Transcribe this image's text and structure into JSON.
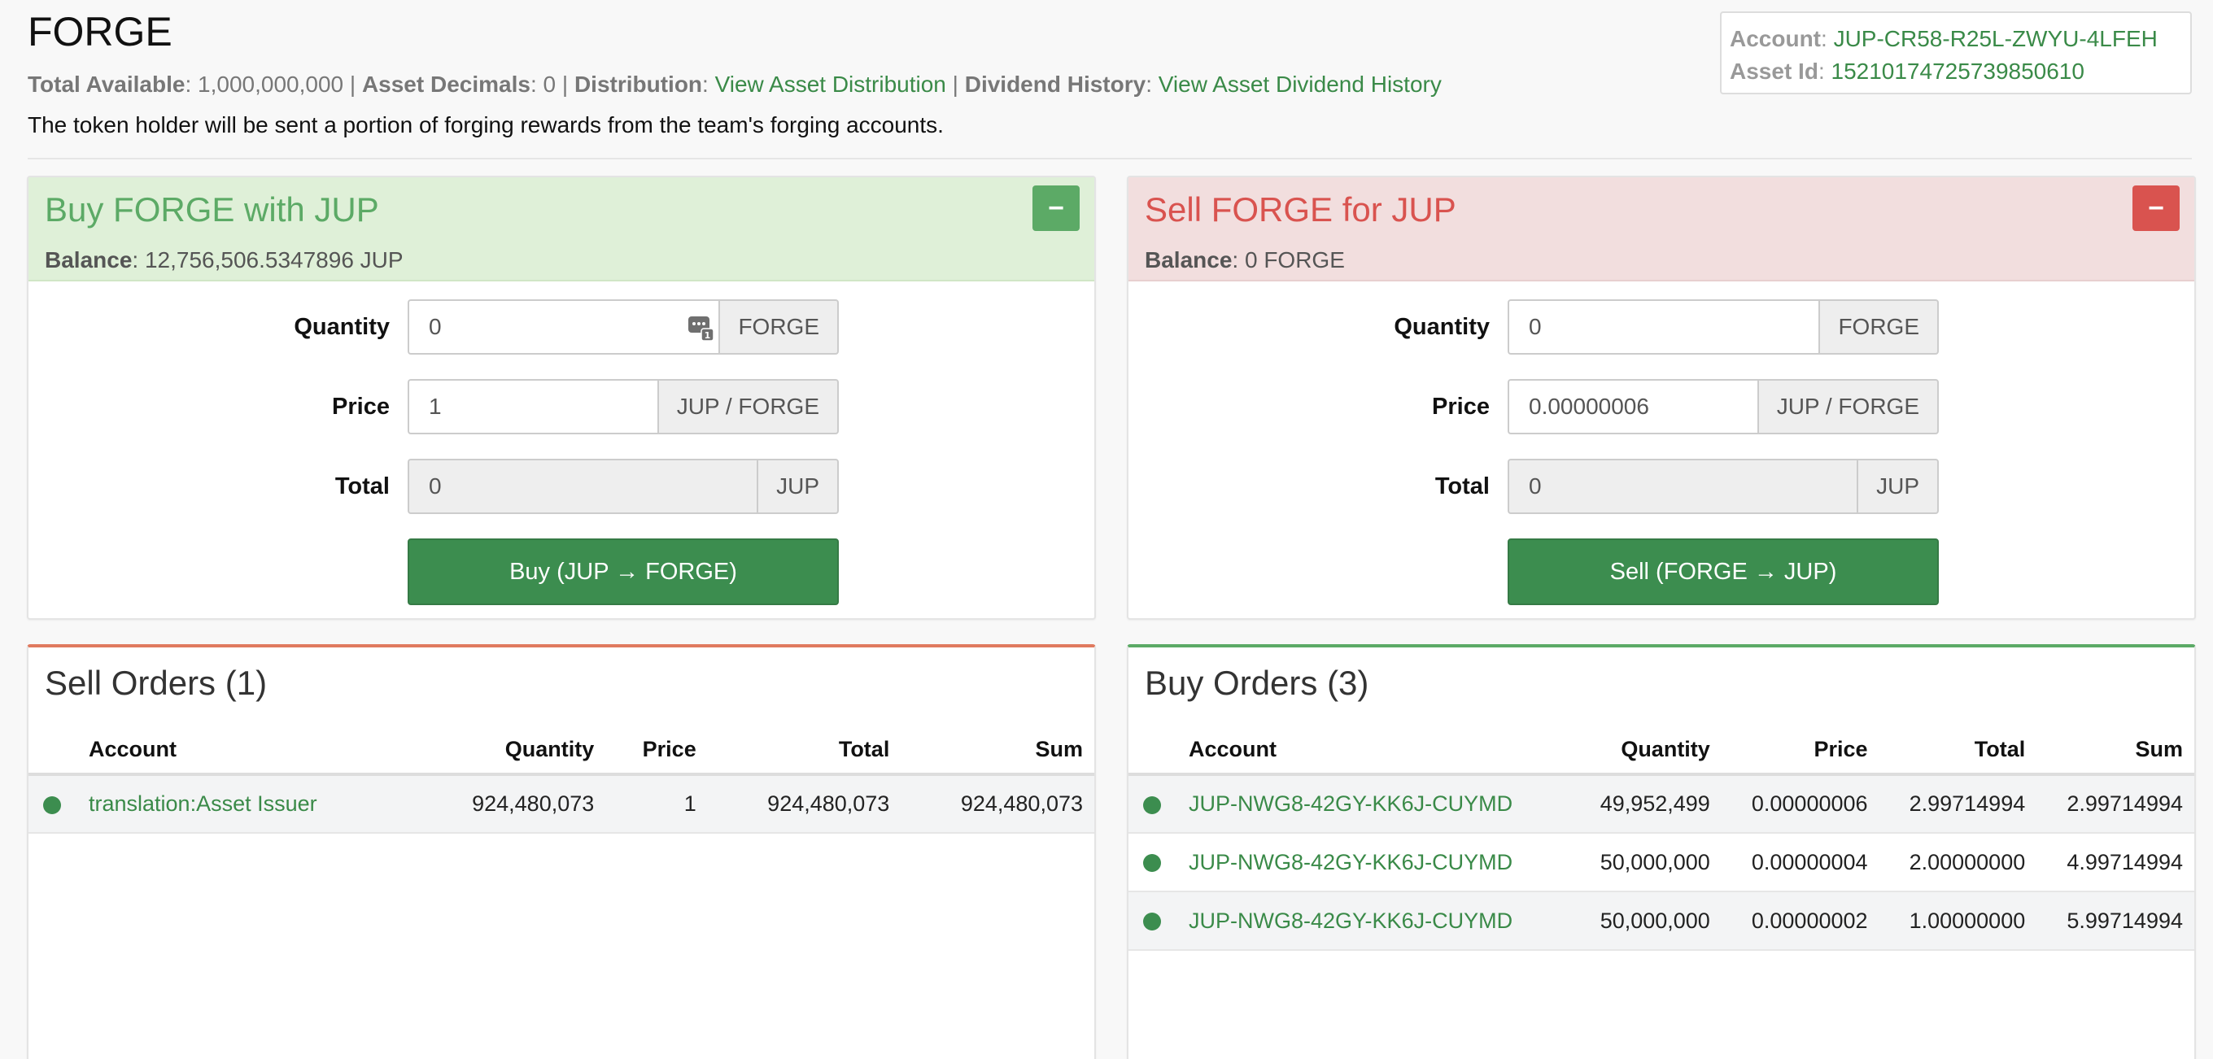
{
  "asset": {
    "name": "FORGE",
    "total_available_label": "Total Available",
    "total_available": "1,000,000,000",
    "decimals_label": "Asset Decimals",
    "decimals": "0",
    "distribution_label": "Distribution",
    "distribution_link": "View Asset Distribution",
    "dividend_label": "Dividend History",
    "dividend_link": "View Asset Dividend History",
    "description": "The token holder will be sent a portion of forging rewards from the team's forging accounts."
  },
  "info_box": {
    "account_label": "Account",
    "account": "JUP-CR58-R25L-ZWYU-4LFEH",
    "asset_id_label": "Asset Id",
    "asset_id": "15210174725739850610"
  },
  "buy_panel": {
    "title": "Buy FORGE with JUP",
    "balance_label": "Balance",
    "balance": "12,756,506.5347896 JUP",
    "collapse": "−",
    "quantity_label": "Quantity",
    "quantity_value": "0",
    "quantity_unit": "FORGE",
    "price_label": "Price",
    "price_value": "1",
    "price_unit": "JUP / FORGE",
    "total_label": "Total",
    "total_value": "0",
    "total_unit": "JUP",
    "button": "Buy (JUP → FORGE)"
  },
  "sell_panel": {
    "title": "Sell FORGE for JUP",
    "balance_label": "Balance",
    "balance": "0 FORGE",
    "collapse": "−",
    "quantity_label": "Quantity",
    "quantity_value": "0",
    "quantity_unit": "FORGE",
    "price_label": "Price",
    "price_value": "0.00000006",
    "price_unit": "JUP / FORGE",
    "total_label": "Total",
    "total_value": "0",
    "total_unit": "JUP",
    "button": "Sell (FORGE → JUP)"
  },
  "sell_orders": {
    "title": "Sell Orders (1)",
    "headers": [
      "Account",
      "Quantity",
      "Price",
      "Total",
      "Sum"
    ],
    "rows": [
      [
        "translation:Asset Issuer",
        "924,480,073",
        "1",
        "924,480,073",
        "924,480,073"
      ]
    ]
  },
  "buy_orders": {
    "title": "Buy Orders (3)",
    "headers": [
      "Account",
      "Quantity",
      "Price",
      "Total",
      "Sum"
    ],
    "rows": [
      [
        "JUP-NWG8-42GY-KK6J-CUYMD",
        "49,952,499",
        "0.00000006",
        "2.99714994",
        "2.99714994"
      ],
      [
        "JUP-NWG8-42GY-KK6J-CUYMD",
        "50,000,000",
        "0.00000004",
        "2.00000000",
        "4.99714994"
      ],
      [
        "JUP-NWG8-42GY-KK6J-CUYMD",
        "50,000,000",
        "0.00000002",
        "1.00000000",
        "5.99714994"
      ]
    ]
  },
  "colors": {
    "link_green": "#3a8a48",
    "buy_header_bg": "#dff0d8",
    "sell_header_bg": "#f2dede",
    "buy_accent": "#5caa66",
    "sell_accent": "#d9534f",
    "button_green": "#3c8d4f"
  },
  "icons": {
    "calculator": "calculator-icon",
    "status_dot": "status-dot-icon"
  }
}
